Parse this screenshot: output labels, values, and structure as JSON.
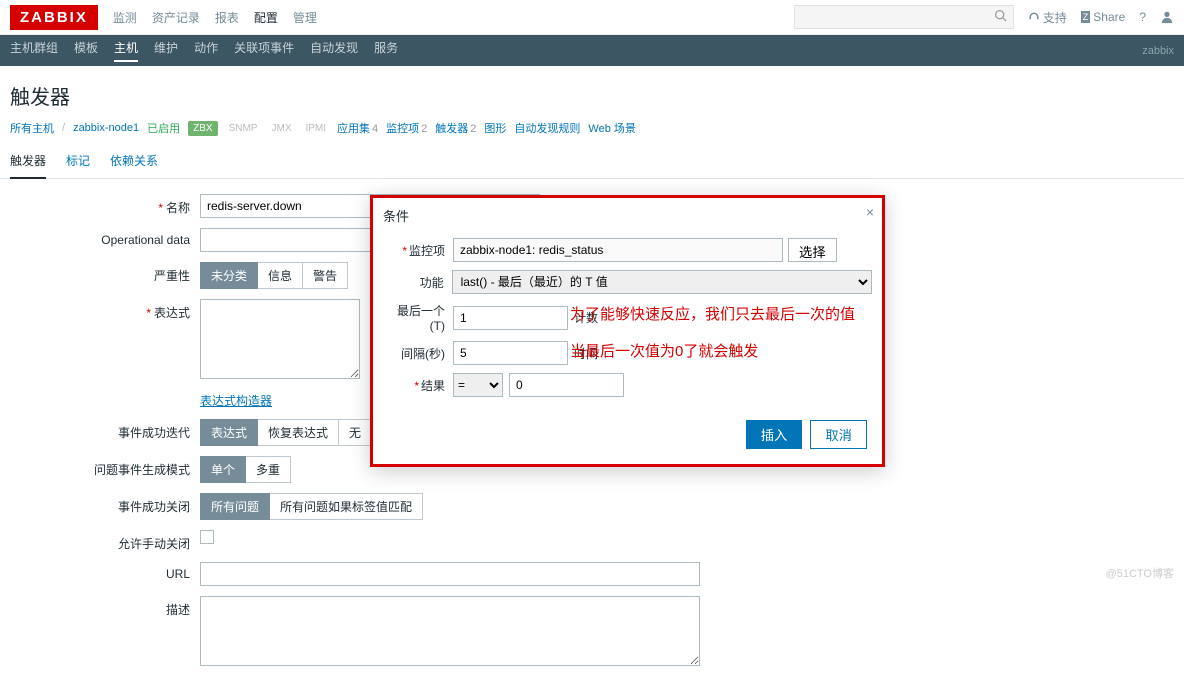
{
  "topbar": {
    "logo": "ZABBIX",
    "nav": [
      "监测",
      "资产记录",
      "报表",
      "配置",
      "管理"
    ],
    "active_nav": 3,
    "support": "支持",
    "share": "Share"
  },
  "subnav": {
    "items": [
      "主机群组",
      "模板",
      "主机",
      "维护",
      "动作",
      "关联项事件",
      "自动发现",
      "服务"
    ],
    "active": 2,
    "right": "zabbix"
  },
  "page_title": "触发器",
  "host_row": {
    "all_hosts": "所有主机",
    "host": "zabbix-node1",
    "enabled": "已启用",
    "zbx": "ZBX",
    "snmp": "SNMP",
    "jmx": "JMX",
    "ipmi": "IPMI",
    "apps": {
      "label": "应用集",
      "count": "4"
    },
    "items": {
      "label": "监控项",
      "count": "2"
    },
    "triggers": {
      "label": "触发器",
      "count": "2"
    },
    "graphs": "图形",
    "discovery": "自动发现规则",
    "web": "Web 场景"
  },
  "tabs": [
    "触发器",
    "标记",
    "依赖关系"
  ],
  "form": {
    "name_label": "名称",
    "name_value": "redis-server.down",
    "opdata_label": "Operational data",
    "severity_label": "严重性",
    "severity_opts": [
      "未分类",
      "信息",
      "警告"
    ],
    "expr_label": "表达式",
    "expr_builder": "表达式构造器",
    "event_ok_label": "事件成功迭代",
    "event_ok_opts": [
      "表达式",
      "恢复表达式",
      "无"
    ],
    "problem_mode_label": "问题事件生成模式",
    "problem_mode_opts": [
      "单个",
      "多重"
    ],
    "ok_close_label": "事件成功关闭",
    "ok_close_opts": [
      "所有问题",
      "所有问题如果标签值匹配"
    ],
    "manual_close_label": "允许手动关闭",
    "url_label": "URL",
    "desc_label": "描述"
  },
  "modal": {
    "title": "条件",
    "item_label": "监控项",
    "item_value": "zabbix-node1: redis_status",
    "select_btn": "选择",
    "func_label": "功能",
    "func_value": "last() - 最后（最近）的 T 值",
    "last_label": "最后一个 (T)",
    "last_value": "1",
    "last_unit": "计数",
    "interval_label": "间隔(秒)",
    "interval_value": "5",
    "interval_unit": "时间",
    "result_label": "结果",
    "result_op": "=",
    "result_value": "0",
    "insert": "插入",
    "cancel": "取消"
  },
  "annotations": {
    "line1": "为了能够快速反应，我们只去最后一次的值",
    "line2": "当最后一次值为0了就会触发"
  },
  "watermark": "@51CTO博客"
}
